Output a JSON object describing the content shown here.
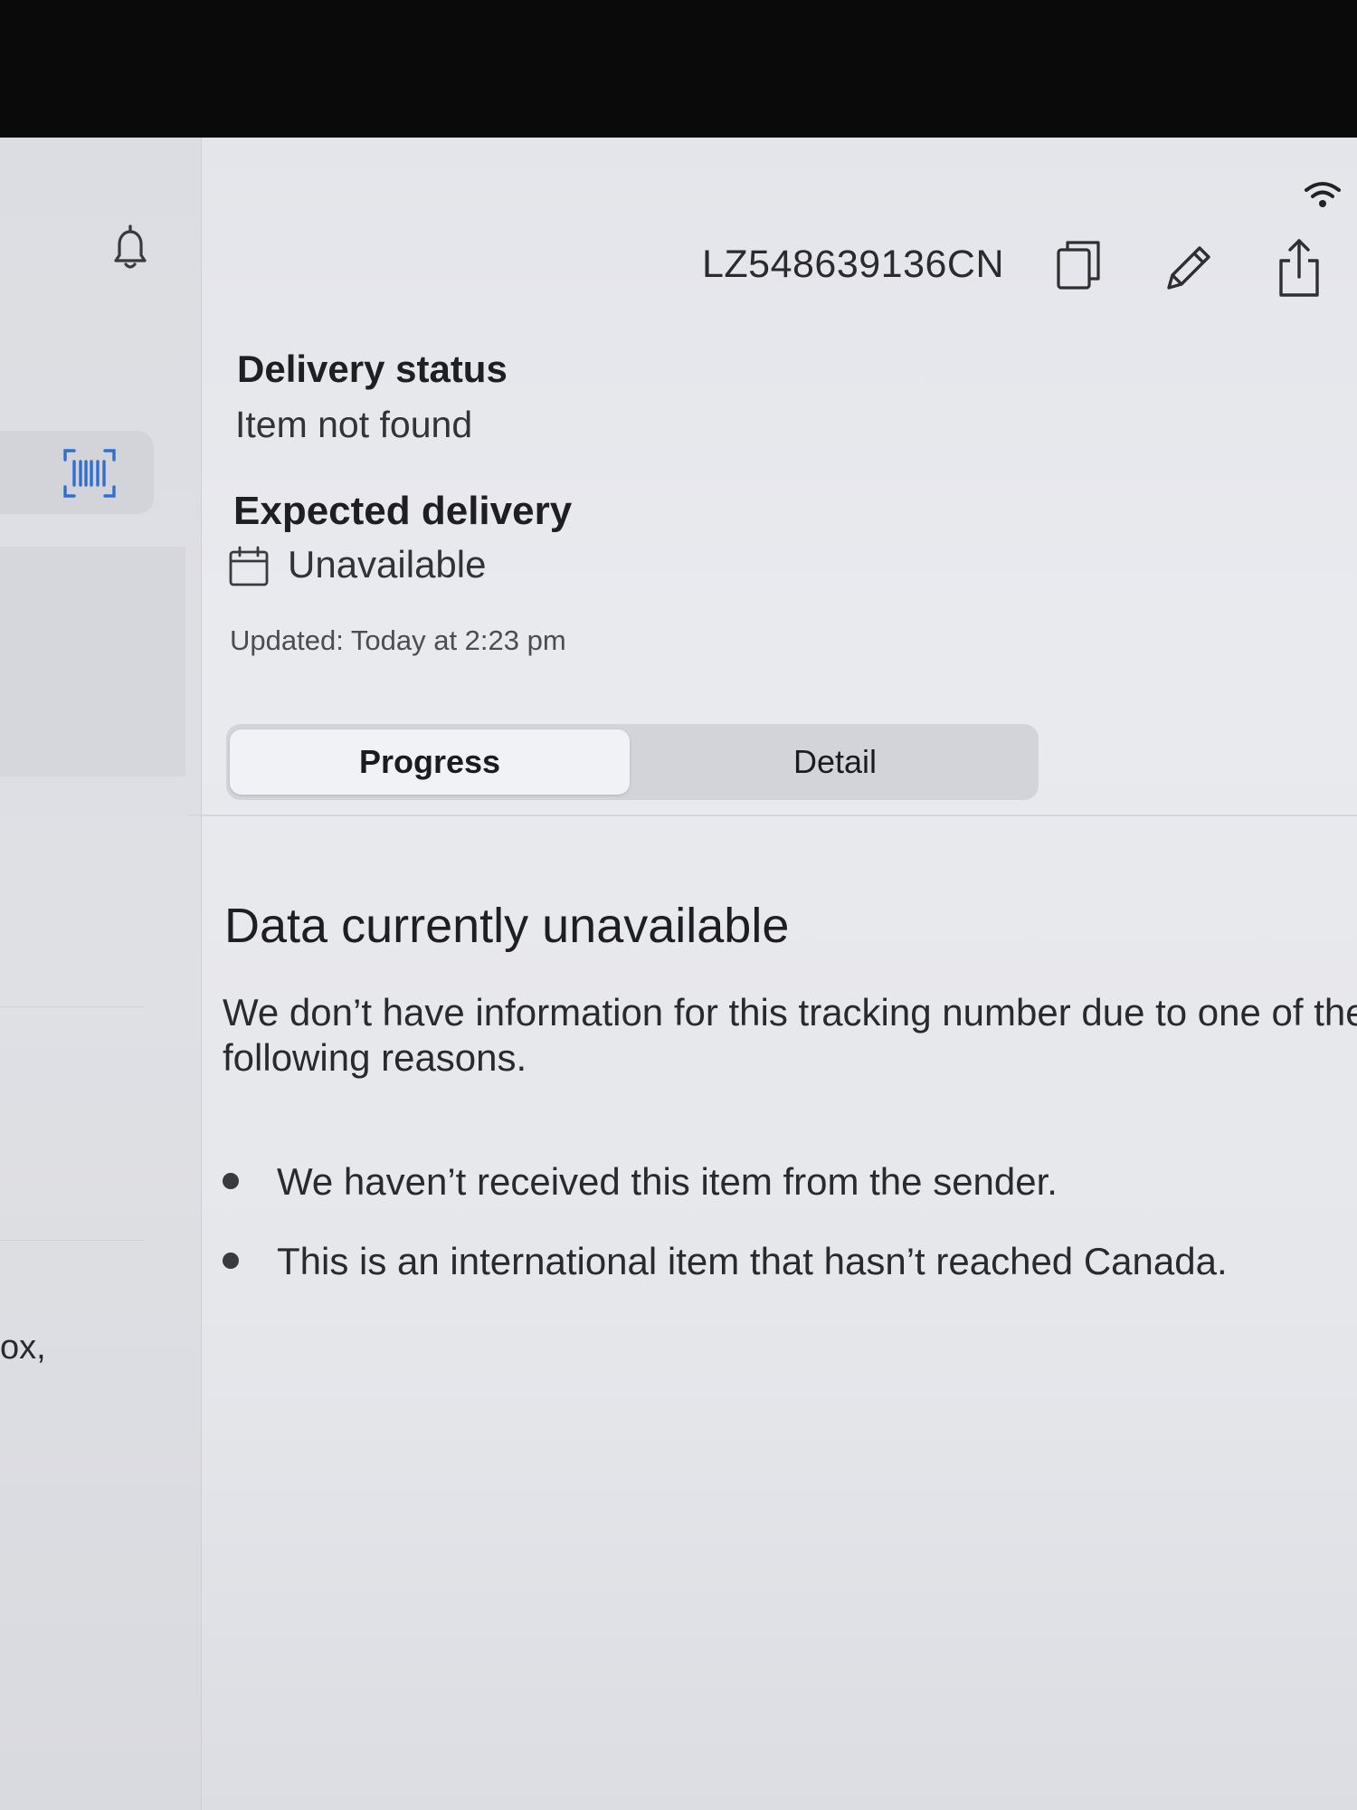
{
  "sidebar": {
    "bell_icon": "bell-icon",
    "scan_icon": "barcode-scan-icon",
    "partial_text": "ox,"
  },
  "header": {
    "tracking_number": "LZ548639136CN",
    "copy_icon": "copy-icon",
    "edit_icon": "pencil-icon",
    "share_icon": "share-icon",
    "wifi_icon": "wifi-icon"
  },
  "status": {
    "delivery_status_label": "Delivery status",
    "delivery_status_value": "Item not found",
    "expected_delivery_label": "Expected delivery",
    "expected_delivery_value": "Unavailable",
    "calendar_icon": "calendar-icon",
    "updated_text": "Updated: Today at 2:23 pm"
  },
  "tabs": [
    {
      "label": "Progress",
      "selected": true
    },
    {
      "label": "Detail",
      "selected": false
    }
  ],
  "content": {
    "title": "Data currently unavailable",
    "body": "We don’t have information for this tracking number due to one of the following reasons.",
    "reasons": [
      "We haven’t received this item from the sender.",
      "This is an international item that hasn’t reached Canada."
    ]
  },
  "colors": {
    "accent_blue": "#2f6fd1",
    "background": "#e6e7eb",
    "selected_tab": "#f1f2f5"
  }
}
